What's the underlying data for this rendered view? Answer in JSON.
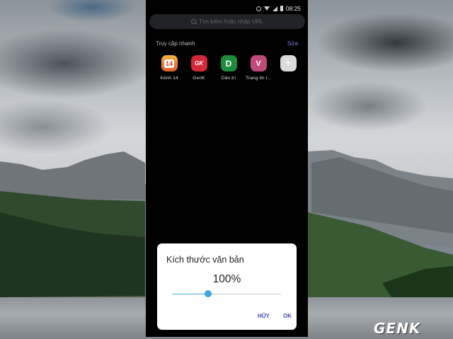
{
  "status_bar": {
    "time": "08:25",
    "icons": [
      "alarm-icon",
      "wifi-icon",
      "signal-icon",
      "battery-icon"
    ]
  },
  "search": {
    "placeholder": "Tìm kiếm hoặc nhập URL",
    "icon": "search-icon"
  },
  "quick_access": {
    "title": "Truy cập nhanh",
    "edit_label": "Sửa",
    "shortcuts": [
      {
        "label": "Kênh 14",
        "tile_text": "14",
        "color": "#e35a2a"
      },
      {
        "label": "GenK",
        "tile_text": "GK",
        "color": "#d3293a"
      },
      {
        "label": "Dân trí",
        "tile_text": "D",
        "color": "#1d8a3d"
      },
      {
        "label": "Trang tin t...",
        "tile_text": "V",
        "color": "#c04a7a"
      },
      {
        "label": "",
        "tile_text": "+",
        "color": "#dadbdd"
      }
    ]
  },
  "text_size_dialog": {
    "title": "Kích thước văn bản",
    "value": "100%",
    "slider_level": 0.33,
    "accent_color": "#3ba7e0",
    "cancel_label": "HỦY",
    "ok_label": "OK"
  },
  "watermark": {
    "text": "GENK"
  }
}
